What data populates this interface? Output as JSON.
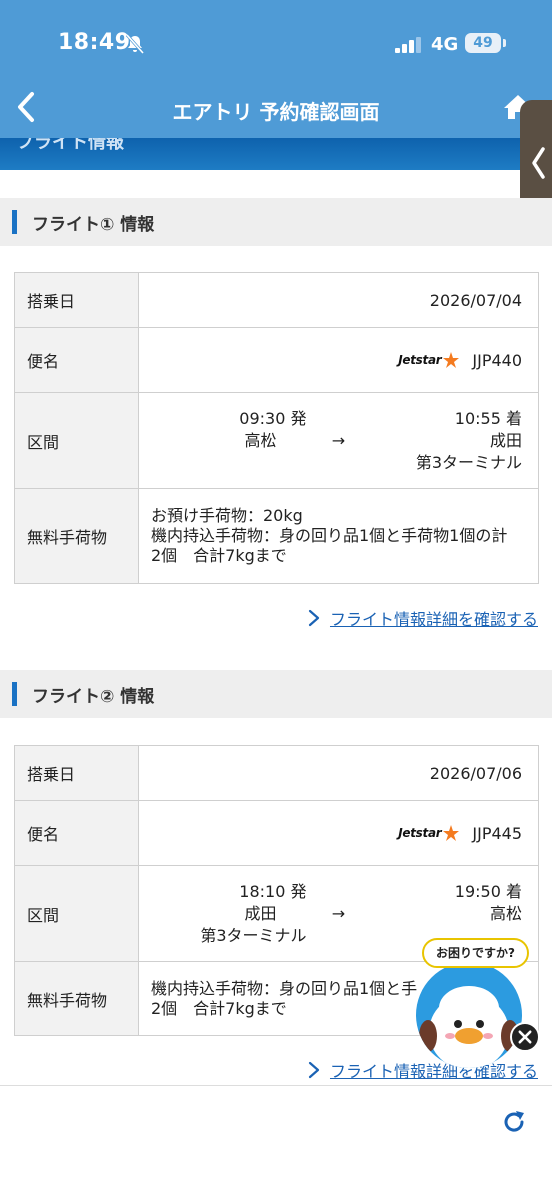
{
  "status_bar": {
    "time": "18:49",
    "network": "4G",
    "battery": "49"
  },
  "nav": {
    "title": "エアトリ 予約確認画面"
  },
  "peek_banner": {
    "text": "フライト情報"
  },
  "flights": [
    {
      "section_title": "フライト① 情報",
      "date_label": "搭乗日",
      "date": "2026/07/04",
      "flight_label": "便名",
      "airline_logo": "Jetstar",
      "flight_no": "JJP440",
      "route_label": "区間",
      "dep_time": "09:30 発",
      "dep_airport": "高松",
      "dep_terminal": "",
      "arrow": "→",
      "arr_time": "10:55 着",
      "arr_airport": "成田",
      "arr_terminal": "第3ターミナル",
      "baggage_label": "無料手荷物",
      "baggage_line1": "お預け手荷物：20kg",
      "baggage_line2": "機内持込手荷物：身の回り品1個と手荷物1個の計",
      "baggage_line3": "2個　合計7kgまで",
      "detail_link": "フライト情報詳細を確認する"
    },
    {
      "section_title": "フライト② 情報",
      "date_label": "搭乗日",
      "date": "2026/07/06",
      "flight_label": "便名",
      "airline_logo": "Jetstar",
      "flight_no": "JJP445",
      "route_label": "区間",
      "dep_time": "18:10 発",
      "dep_airport": "成田",
      "dep_terminal": "第3ターミナル",
      "arrow": "→",
      "arr_time": "19:50 着",
      "arr_airport": "高松",
      "arr_terminal": "",
      "baggage_label": "無料手荷物",
      "baggage_line1": "機内持込手荷物：身の回り品1個と手",
      "baggage_line2": "2個　合計7kgまで",
      "detail_link": "フライト情報詳細を確認する"
    }
  ],
  "help": {
    "bubble": "お困りですか?"
  },
  "colors": {
    "header": "#4f9bd6",
    "accent": "#1a72c4",
    "link": "#1a62b4",
    "jetstar_star": "#f47b20"
  },
  "icons": [
    "bell-slash-icon",
    "signal-icon",
    "back-chevron-icon",
    "home-icon",
    "side-chevron-icon",
    "jetstar-star-icon",
    "link-chevron-icon",
    "refresh-icon",
    "close-icon"
  ]
}
